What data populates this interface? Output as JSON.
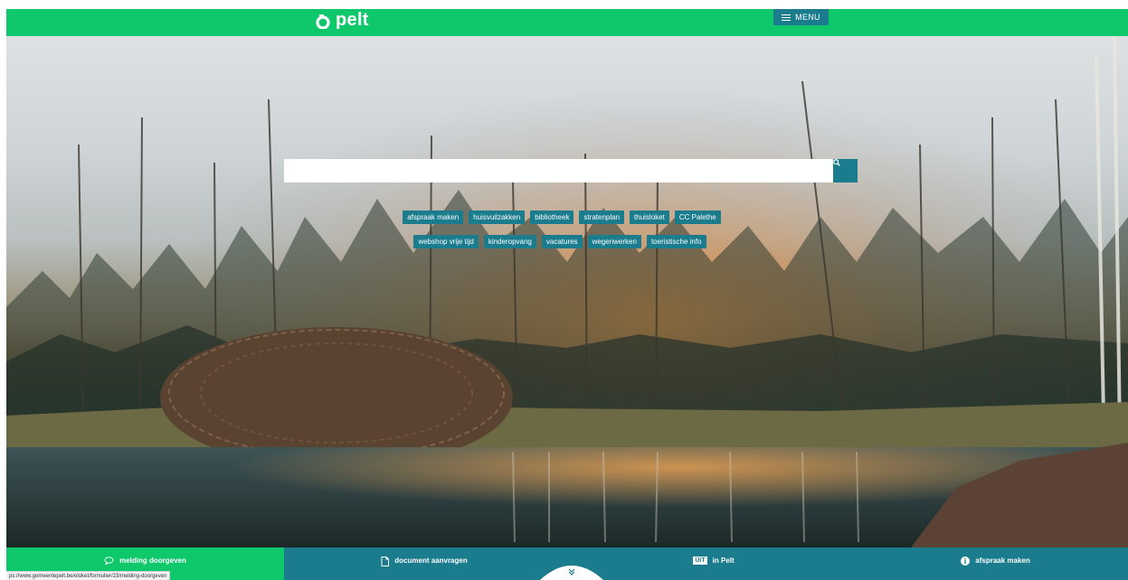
{
  "header": {
    "logo_text": "pelt",
    "menu_label": "MENU"
  },
  "search": {
    "value": "",
    "placeholder": ""
  },
  "quick_links_row1": [
    "afspraak maken",
    "huisvuilzakken",
    "bibliotheek",
    "stratenplan",
    "thuisloket",
    "CC Palethe"
  ],
  "quick_links_row2": [
    "webshop vrije tijd",
    "kinderopvang",
    "vacatures",
    "wegenwerken",
    "toeristische info"
  ],
  "bottom_bar": {
    "melding": "melding doorgeven",
    "document": "document aanvragen",
    "uit_badge": "UiT",
    "uit": "in Pelt",
    "afspraak": "afspraak maken"
  },
  "status_bar": {
    "url": "ps://www.gemeentepelt.be/eloket/formulier/23/melding-doorgeven"
  },
  "colors": {
    "brand_green": "#10c86c",
    "teal": "#1a7c8c"
  },
  "icons": {
    "logo": "pelt-logo-icon",
    "menu": "hamburger-icon",
    "search": "search-icon",
    "melding": "speech-bubble-icon",
    "document": "document-icon",
    "afspraak": "info-icon",
    "scroll": "chevron-double-down-icon"
  }
}
